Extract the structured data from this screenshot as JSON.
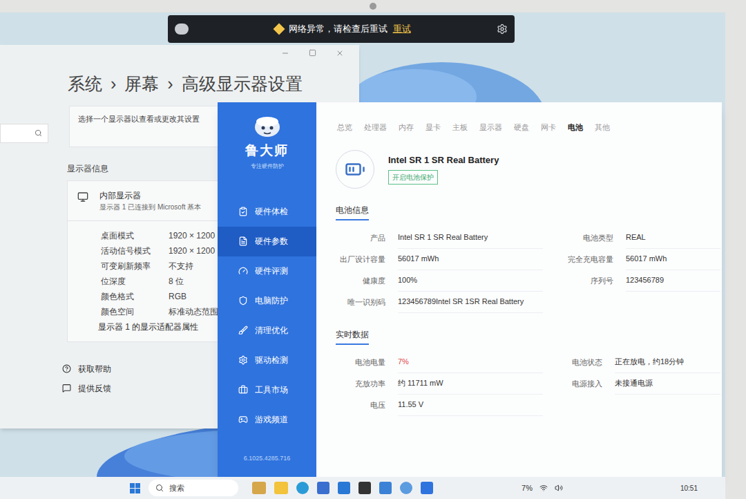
{
  "notification": {
    "text": "网络异常，请检查后重试",
    "action": "重试"
  },
  "settings": {
    "breadcrumb": [
      "系统",
      "屏幕",
      "高级显示器设置"
    ],
    "separator": "›",
    "select_label": "选择一个显示器以查看或更改其设置",
    "section": "显示器信息",
    "display": {
      "name": "内部显示器",
      "detail": "显示器 1 已连接到 Microsoft 基本"
    },
    "rows": [
      {
        "label": "桌面模式",
        "value": "1920 × 1200"
      },
      {
        "label": "活动信号模式",
        "value": "1920 × 1200"
      },
      {
        "label": "可变刷新频率",
        "value": "不支持"
      },
      {
        "label": "位深度",
        "value": "8 位"
      },
      {
        "label": "颜色格式",
        "value": "RGB"
      },
      {
        "label": "颜色空间",
        "value": "标准动态范围"
      }
    ],
    "adapter_link": "显示器 1 的显示适配器属性",
    "links": [
      "获取帮助",
      "提供反馈"
    ]
  },
  "ludashi": {
    "logo": "鲁大师",
    "tagline": "专注硬件防护",
    "nav": [
      {
        "label": "硬件体检",
        "selected": false
      },
      {
        "label": "硬件参数",
        "selected": true
      },
      {
        "label": "硬件评测",
        "selected": false
      },
      {
        "label": "电脑防护",
        "selected": false
      },
      {
        "label": "清理优化",
        "selected": false
      },
      {
        "label": "驱动检测",
        "selected": false
      },
      {
        "label": "工具市场",
        "selected": false
      },
      {
        "label": "游戏频道",
        "selected": false
      }
    ],
    "version": "6.1025.4285.716",
    "tabs": [
      {
        "label": "总览",
        "selected": false
      },
      {
        "label": "处理器",
        "selected": false
      },
      {
        "label": "内存",
        "selected": false
      },
      {
        "label": "显卡",
        "selected": false
      },
      {
        "label": "主板",
        "selected": false
      },
      {
        "label": "显示器",
        "selected": false
      },
      {
        "label": "硬盘",
        "selected": false
      },
      {
        "label": "网卡",
        "selected": false
      },
      {
        "label": "电池",
        "selected": true
      },
      {
        "label": "其他",
        "selected": false
      }
    ],
    "battery_name": "Intel SR 1 SR Real Battery",
    "protect_button": "开启电池保护",
    "info_section": "电池信息",
    "info_left": [
      {
        "label": "产品",
        "value": "Intel SR 1 SR Real Battery"
      },
      {
        "label": "出厂设计容量",
        "value": "56017 mWh"
      },
      {
        "label": "健康度",
        "value": "100%"
      },
      {
        "label": "唯一识别码",
        "value": "123456789Intel SR 1SR Real Battery"
      }
    ],
    "info_right": [
      {
        "label": "电池类型",
        "value": "REAL"
      },
      {
        "label": "完全充电容量",
        "value": "56017 mWh"
      },
      {
        "label": "序列号",
        "value": "123456789"
      }
    ],
    "live_section": "实时数据",
    "live_left": [
      {
        "label": "电池电量",
        "value": "7%",
        "alert": true
      },
      {
        "label": "充放功率",
        "value": "约 11711 mW",
        "alert": false
      },
      {
        "label": "电压",
        "value": "11.55 V",
        "alert": false
      }
    ],
    "live_right": [
      {
        "label": "电池状态",
        "value": "正在放电，约18分钟"
      },
      {
        "label": "电源接入",
        "value": "未接通电源"
      }
    ]
  },
  "taskbar": {
    "search": "搜索",
    "battery": "7%",
    "time": "10:51"
  }
}
